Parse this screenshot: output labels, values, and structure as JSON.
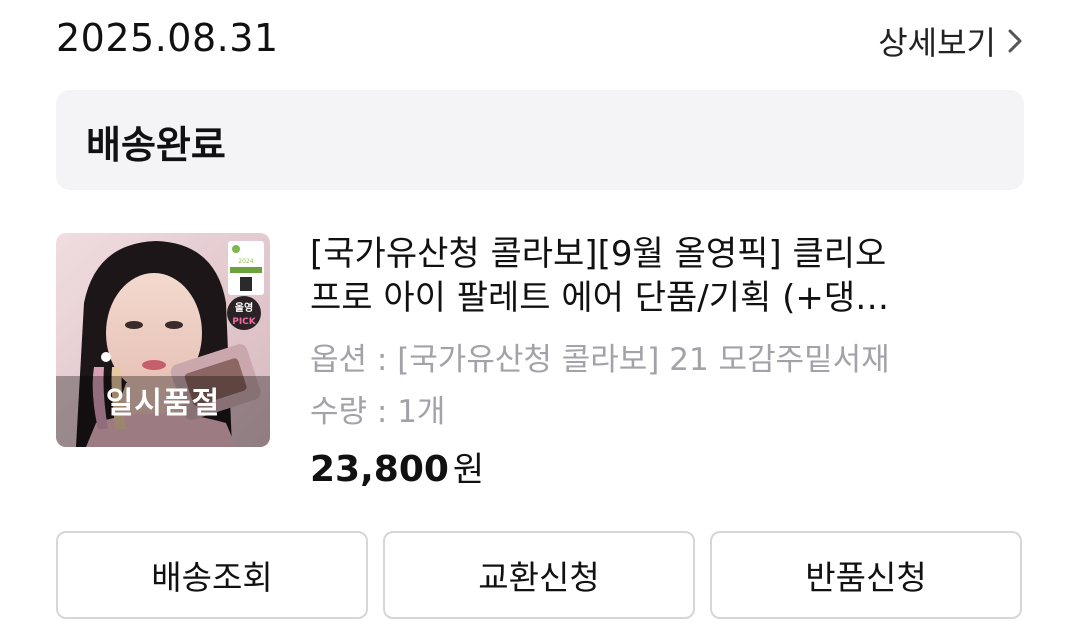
{
  "order": {
    "date": "2025.08.31",
    "detail_link": "상세보기",
    "status": "배송완료"
  },
  "product": {
    "title_line1": "[국가유산청 콜라보][9월 올영픽] 클리오",
    "title_line2": "프로 아이 팔레트 에어 단품/기획 (+댕…",
    "option": "옵션 : [국가유산청 콜라보] 21 모감주밑서재",
    "quantity": "수량 : 1개",
    "price": "23,800",
    "currency": "원",
    "badge_overlay": "일시품절",
    "image_badges": {
      "awards_year": "2024",
      "awards_text": "OLIVE YOUNG AWARDS",
      "pick_line1": "올영",
      "pick_line2": "PICK"
    }
  },
  "buttons": {
    "track": "배송조회",
    "exchange": "교환신청",
    "return": "반품신청"
  }
}
